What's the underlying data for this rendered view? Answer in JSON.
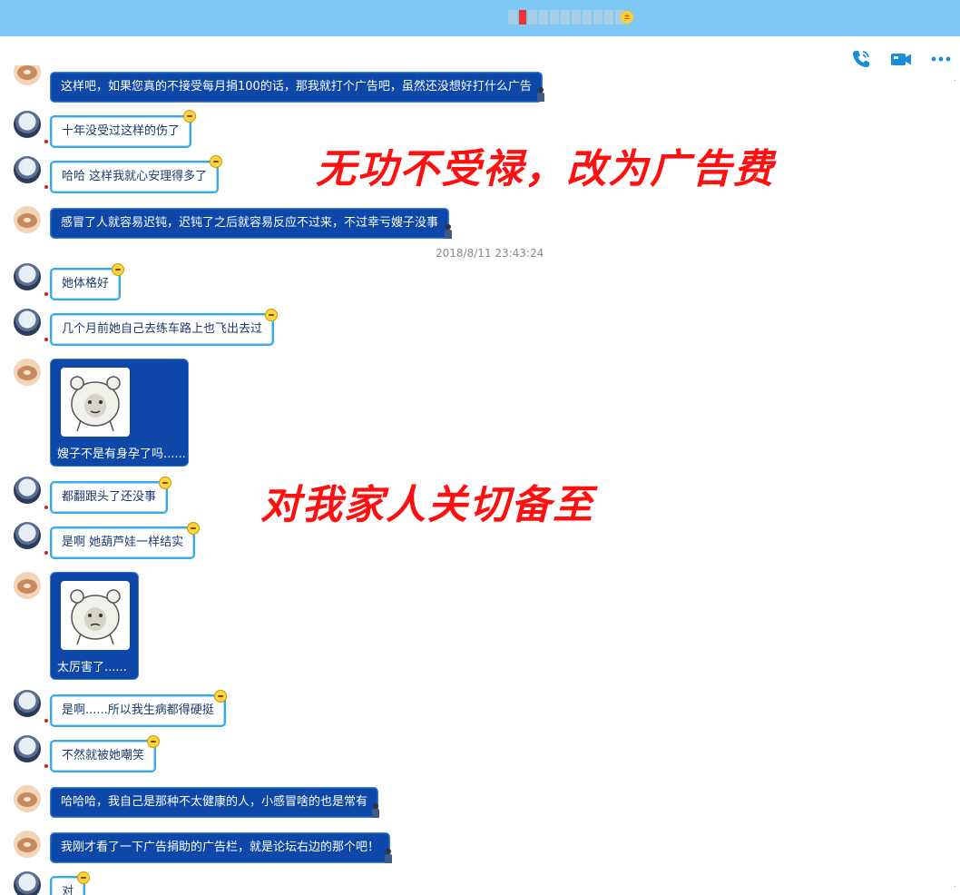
{
  "titlebar": {
    "badge": "±"
  },
  "toolbar": {
    "icons": [
      "phone-call-icon",
      "video-call-icon",
      "more-options-icon"
    ]
  },
  "overlays": {
    "caption1": "无功不受禄，改为广告费",
    "caption2": "对我家人关切备至"
  },
  "timestamp": "2018/8/11 23:43:24",
  "messages": [
    {
      "sender": "bear",
      "text": "这样吧，如果您真的不接受每月捐100的话，那我就打个广告吧，虽然还没想好打什么广告"
    },
    {
      "sender": "boy",
      "text": "十年没受过这样的伤了"
    },
    {
      "sender": "boy",
      "text": "哈哈 这样我就心安理得多了"
    },
    {
      "sender": "bear",
      "text": "感冒了人就容易迟钝，迟钝了之后就容易反应不过来，不过幸亏嫂子没事"
    },
    {
      "sender": "boy",
      "text": "她体格好"
    },
    {
      "sender": "boy",
      "text": "几个月前她自己去练车路上也飞出去过"
    },
    {
      "sender": "bear",
      "text": "嫂子不是有身孕了吗......"
    },
    {
      "sender": "boy",
      "text": "都翻跟头了还没事"
    },
    {
      "sender": "boy",
      "text": "是啊 她葫芦娃一样结实"
    },
    {
      "sender": "bear",
      "text": "太厉害了......"
    },
    {
      "sender": "boy",
      "text": "是啊......所以我生病都得硬挺"
    },
    {
      "sender": "boy",
      "text": "不然就被她嘲笑"
    },
    {
      "sender": "bear",
      "text": "哈哈哈，我自己是那种不太健康的人，小感冒啥的也是常有"
    },
    {
      "sender": "bear",
      "text": "我刚才看了一下广告捐助的广告栏，就是论坛右边的那个吧！"
    },
    {
      "sender": "boy",
      "text": "对"
    }
  ],
  "colors": {
    "titlebar": "#7ec8f6",
    "dark_bubble": "#0d47a8",
    "light_bubble_border": "#38a9e8",
    "overlay_text": "#ff1010",
    "icon_blue": "#1a8fd8"
  }
}
